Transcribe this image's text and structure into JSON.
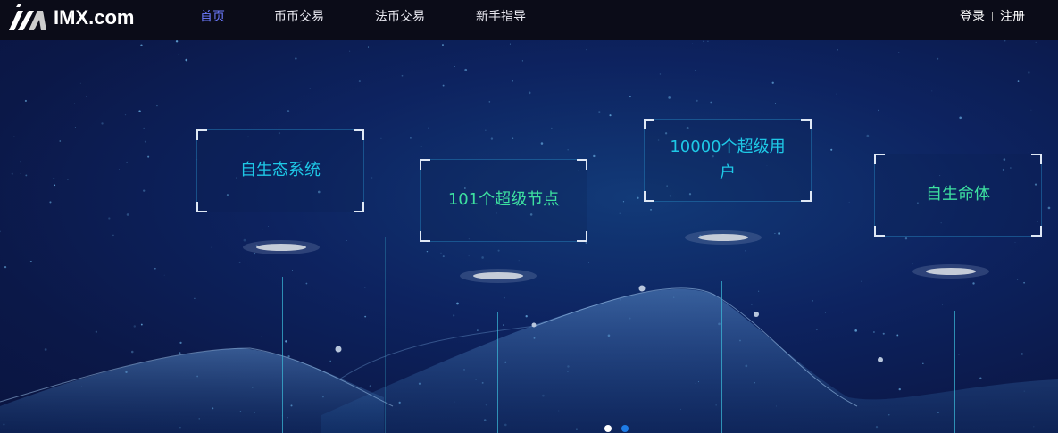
{
  "header": {
    "brand": "IMX.com",
    "nav": [
      {
        "label": "首页",
        "active": true
      },
      {
        "label": "币币交易"
      },
      {
        "label": "法币交易"
      },
      {
        "label": "新手指导"
      }
    ],
    "login": "登录",
    "register": "注册"
  },
  "hero": {
    "cards": [
      {
        "text": "自生态系统",
        "color": "#1ec8e6"
      },
      {
        "text": "101个超级节点",
        "color": "#3de0a0"
      },
      {
        "text": "10000个超级用户",
        "color": "#1ec8e6"
      },
      {
        "text": "自生命体",
        "color": "#3de0a0"
      }
    ],
    "carousel": {
      "slides": 2,
      "active": 1
    }
  },
  "colors": {
    "header_bg": "#0b0c18",
    "nav_active": "#6d7bff"
  }
}
